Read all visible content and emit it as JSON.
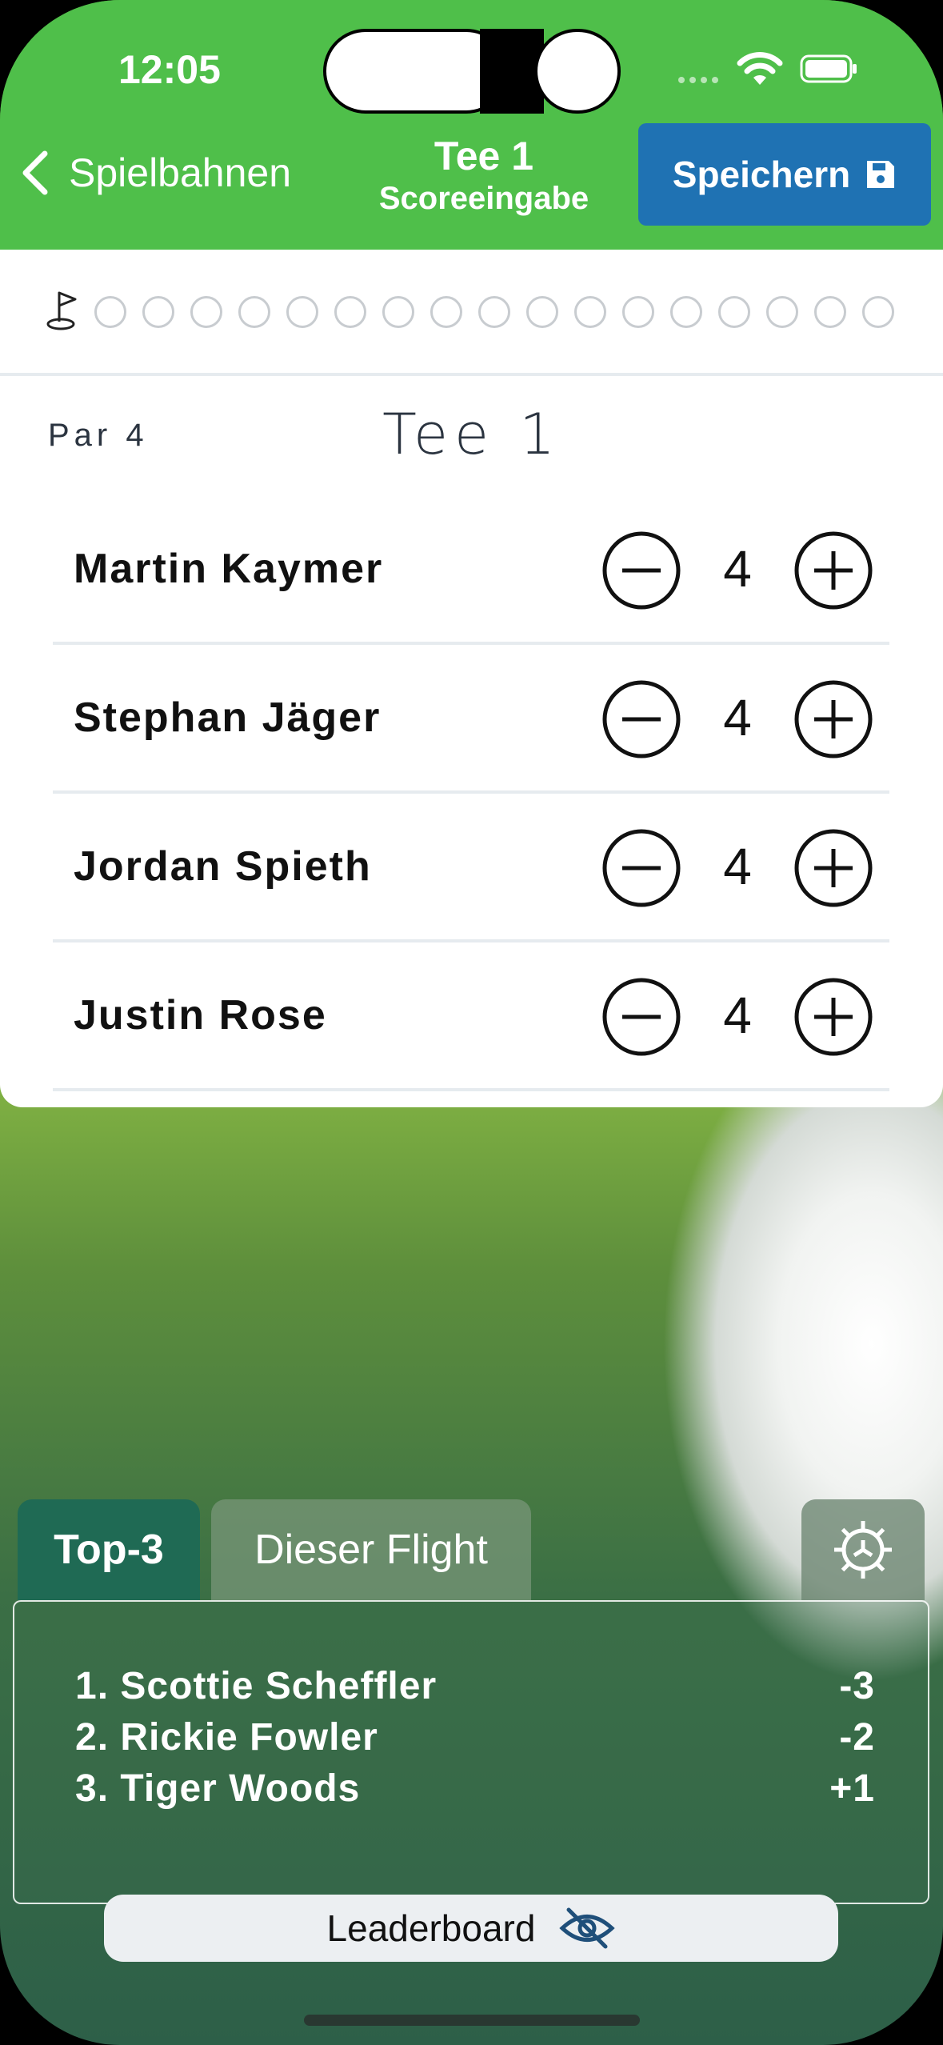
{
  "status_bar": {
    "time": "12:05"
  },
  "header": {
    "back_label": "Spielbahnen",
    "title": "Tee 1",
    "subtitle": "Scoreeingabe",
    "save_label": "Speichern"
  },
  "hole_progress": {
    "total_holes": 17,
    "current": 1
  },
  "hole": {
    "par_label": "Par 4",
    "title": "Tee 1"
  },
  "players": [
    {
      "name": "Martin Kaymer",
      "score": "4"
    },
    {
      "name": "Stephan Jäger",
      "score": "4"
    },
    {
      "name": "Jordan Spieth",
      "score": "4"
    },
    {
      "name": "Justin Rose",
      "score": "4"
    }
  ],
  "leaderboard": {
    "tabs": [
      {
        "label": "Top-3",
        "active": true
      },
      {
        "label": "Dieser Flight",
        "active": false
      }
    ],
    "entries": [
      {
        "name": "1. Scottie Scheffler",
        "score": "-3"
      },
      {
        "name": "2. Rickie Fowler",
        "score": "-2"
      },
      {
        "name": "3. Tiger Woods",
        "score": "+1"
      }
    ],
    "toggle_label": "Leaderboard"
  },
  "colors": {
    "header_green": "#4fbf4a",
    "save_blue": "#1f72b3",
    "active_tab": "#1e6955"
  }
}
